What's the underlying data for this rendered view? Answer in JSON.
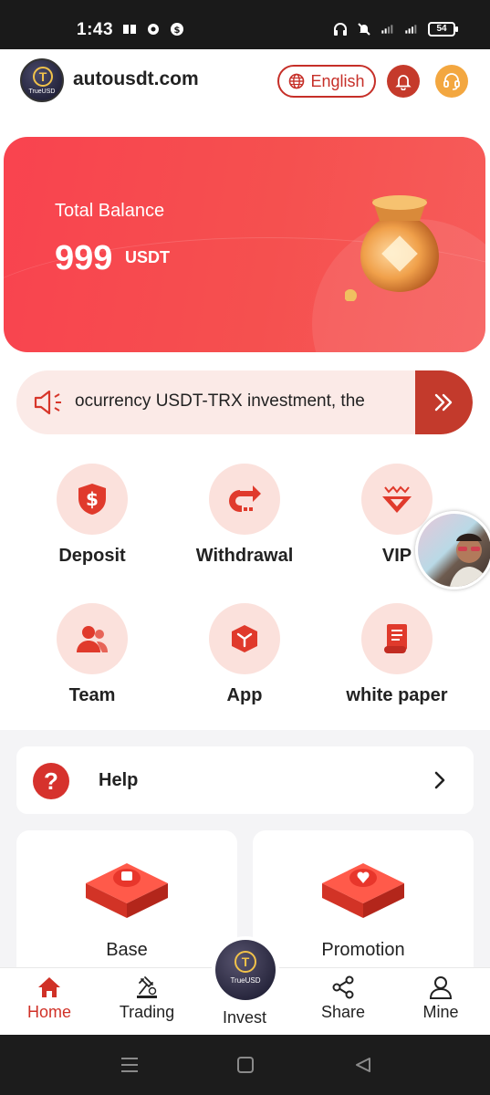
{
  "status_bar": {
    "time": "1:43",
    "battery": "54"
  },
  "header": {
    "site_name": "autousdt.com",
    "logo_text": "TrueUSD",
    "logo_mark": "T",
    "language_label": "English"
  },
  "balance": {
    "label": "Total Balance",
    "amount": "999",
    "unit": "USDT"
  },
  "notice": {
    "text": "ocurrency USDT-TRX investment, the"
  },
  "quick_actions": [
    {
      "label": "Deposit",
      "icon": "dollar-shield-icon"
    },
    {
      "label": "Withdrawal",
      "icon": "withdraw-arrow-icon"
    },
    {
      "label": "VIP",
      "icon": "vip-crown-icon"
    },
    {
      "label": "Team",
      "icon": "team-people-icon"
    },
    {
      "label": "App",
      "icon": "app-box-icon"
    },
    {
      "label": "white paper",
      "icon": "document-scroll-icon"
    }
  ],
  "help": {
    "label": "Help"
  },
  "tiles": [
    {
      "label": "Base"
    },
    {
      "label": "Promotion"
    }
  ],
  "tabbar": {
    "items": [
      {
        "label": "Home",
        "active": true
      },
      {
        "label": "Trading",
        "active": false
      },
      {
        "label": "Invest",
        "active": false
      },
      {
        "label": "Share",
        "active": false
      },
      {
        "label": "Mine",
        "active": false
      }
    ],
    "invest_logo_text": "TrueUSD",
    "invest_logo_mark": "T"
  },
  "colors": {
    "primary": "#d03127",
    "card_red": "#f9434f",
    "support_orange": "#f3a740",
    "icon_bg": "#fbe1dc"
  }
}
